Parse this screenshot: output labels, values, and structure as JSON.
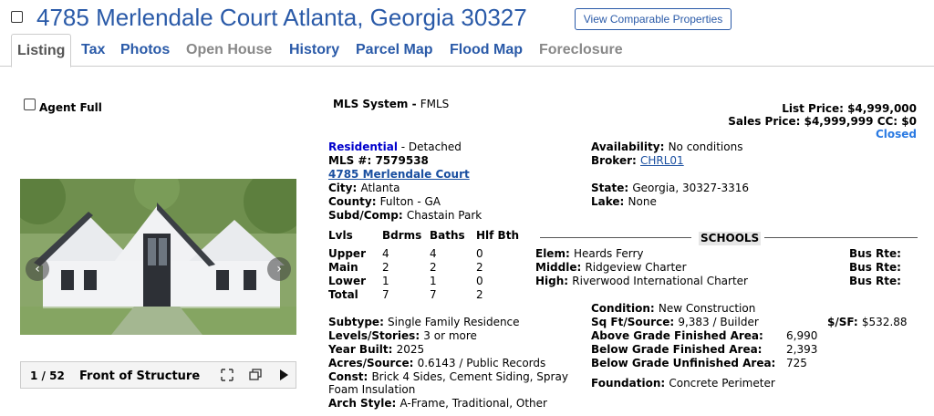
{
  "header": {
    "title": "4785 Merlendale Court Atlanta, Georgia 30327",
    "comp_button": "View Comparable Properties"
  },
  "tabs": [
    {
      "label": "Listing",
      "state": "active"
    },
    {
      "label": "Tax",
      "state": "link"
    },
    {
      "label": "Photos",
      "state": "link"
    },
    {
      "label": "Open House",
      "state": "disabled"
    },
    {
      "label": "History",
      "state": "link"
    },
    {
      "label": "Parcel Map",
      "state": "link"
    },
    {
      "label": "Flood Map",
      "state": "link"
    },
    {
      "label": "Foreclosure",
      "state": "disabled"
    }
  ],
  "agent_full": "Agent Full",
  "mls_system": {
    "label": "MLS System - ",
    "value": "FMLS"
  },
  "prices": {
    "list_label": "List Price: ",
    "list_value": "$4,999,000",
    "sales_label": "Sales Price: ",
    "sales_value": "$4,999,999",
    "cc_label": " CC: ",
    "cc_value": "$0",
    "status": "Closed"
  },
  "listing": {
    "type": "Residential",
    "type_suffix": " - Detached",
    "mls_label": "MLS #: ",
    "mls_value": "7579538",
    "address_link": "4785 Merlendale Court",
    "city_label": "City: ",
    "city_value": "Atlanta",
    "county_label": "County: ",
    "county_value": "Fulton - GA",
    "subd_label": "Subd/Comp: ",
    "subd_value": "Chastain Park"
  },
  "right_info": {
    "avail_label": "Availability: ",
    "avail_value": "No conditions",
    "broker_label": "Broker: ",
    "broker_value": "CHRL01",
    "state_label": "State: ",
    "state_value": "Georgia, 30327-3316",
    "lake_label": "Lake: ",
    "lake_value": "None"
  },
  "levels": {
    "headers": [
      "Lvls",
      "Bdrms",
      "Baths",
      "Hlf Bth"
    ],
    "rows": [
      [
        "Upper",
        "4",
        "4",
        "0"
      ],
      [
        "Main",
        "2",
        "2",
        "2"
      ],
      [
        "Lower",
        "1",
        "1",
        "0"
      ],
      [
        "Total",
        "7",
        "7",
        "2"
      ]
    ]
  },
  "schools": {
    "title": "SCHOOLS",
    "rows": [
      {
        "label": "Elem: ",
        "value": "Heards Ferry",
        "bus": "Bus Rte:"
      },
      {
        "label": "Middle: ",
        "value": "Ridgeview Charter",
        "bus": "Bus Rte:"
      },
      {
        "label": "High: ",
        "value": "Riverwood International Charter",
        "bus": "Bus Rte:"
      }
    ]
  },
  "details_left": {
    "subtype_label": "Subtype: ",
    "subtype_value": "Single Family Residence",
    "levels_label": "Levels/Stories: ",
    "levels_value": "3 or more",
    "year_label": "Year Built: ",
    "year_value": "2025",
    "acres_label": "Acres/Source: ",
    "acres_value": "0.6143 / Public Records",
    "const_label": "Const: ",
    "const_value": "Brick 4 Sides, Cement Siding, Spray",
    "const_value2": "Foam Insulation",
    "arch_label": "Arch Style: ",
    "arch_value": "A-Frame, Traditional, Other"
  },
  "details_right": {
    "cond_label": "Condition: ",
    "cond_value": "New Construction",
    "sqft_label": "Sq Ft/Source: ",
    "sqft_value": "9,383 / Builder",
    "psf_label": "$/SF: ",
    "psf_value": "$532.88",
    "above_label": "Above Grade Finished Area:",
    "above_value": "6,990",
    "below_label": "Below Grade Finished Area:",
    "below_value": "2,393",
    "unfin_label": "Below Grade Unfinished Area:",
    "unfin_value": "725",
    "found_label": "Foundation: ",
    "found_value": "Concrete Perimeter"
  },
  "photo": {
    "counter": "1 / 52",
    "caption": "Front of Structure",
    "icons": [
      "expand-icon",
      "copy-icon",
      "play-icon"
    ]
  }
}
